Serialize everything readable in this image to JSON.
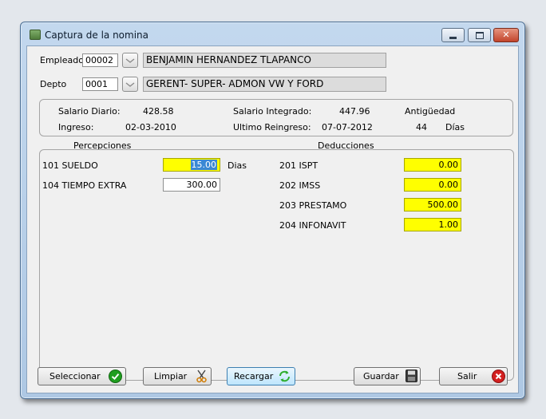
{
  "window": {
    "title": "Captura de la nomina"
  },
  "empleado": {
    "label": "Empleado",
    "code": "00002",
    "name": "BENJAMIN HERNANDEZ TLAPANCO"
  },
  "depto": {
    "label": "Depto",
    "code": "0001",
    "name": "GERENT- SUPER- ADMON VW Y FORD"
  },
  "info": {
    "salario_diario_label": "Salario Diario:",
    "salario_diario": "428.58",
    "salario_integrado_label": "Salario Integrado:",
    "salario_integrado": "447.96",
    "antiguedad_label": "Antigüedad",
    "ingreso_label": "Ingreso:",
    "ingreso": "02-03-2010",
    "ultimo_reingreso_label": "Ultimo Reingreso:",
    "ultimo_reingreso": "07-07-2012",
    "antiguedad_value": "44",
    "dias_label": "Días"
  },
  "percepciones": {
    "title": "Percepciones",
    "items": [
      {
        "label": "101 SUELDO",
        "value": "15.00",
        "unit": "Dias"
      },
      {
        "label": "104 TIEMPO EXTRA",
        "value": "300.00"
      }
    ]
  },
  "deducciones": {
    "title": "Deducciones",
    "items": [
      {
        "label": "201 ISPT",
        "value": "0.00"
      },
      {
        "label": "202 IMSS",
        "value": "0.00"
      },
      {
        "label": "203 PRESTAMO",
        "value": "500.00"
      },
      {
        "label": "204 INFONAVIT",
        "value": "1.00"
      }
    ]
  },
  "buttons": {
    "seleccionar": "Seleccionar",
    "limpiar": "Limpiar",
    "recargar": "Recargar",
    "guardar": "Guardar",
    "salir": "Salir"
  },
  "colors": {
    "highlight_field": "#ffff00",
    "selection": "#3a88d4",
    "ok_green": "#1f9e1f",
    "close_red": "#d42020"
  },
  "icons": {
    "title": "app-icon",
    "seleccionar": "check-icon",
    "limpiar": "scissors-icon",
    "recargar": "refresh-icon",
    "guardar": "floppy-disk-icon",
    "salir": "close-icon"
  }
}
